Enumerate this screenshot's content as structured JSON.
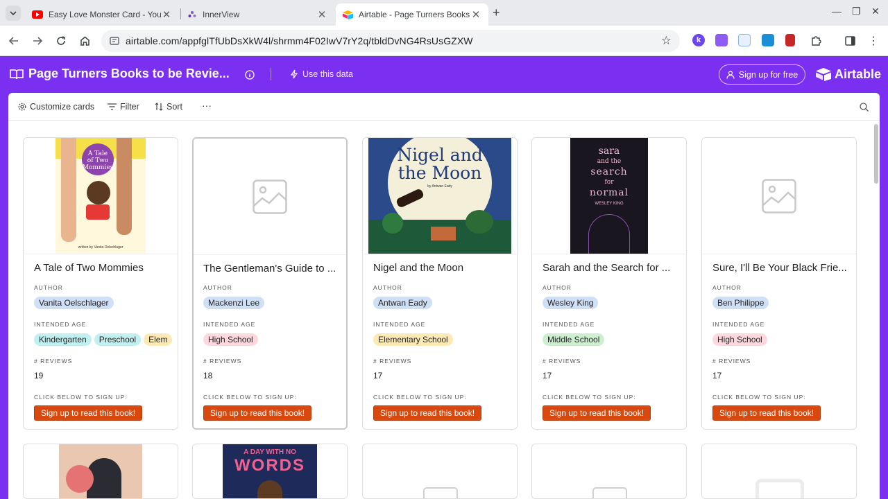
{
  "browser": {
    "tabs": [
      {
        "title": "Easy Love Monster Card - YouT",
        "icon": "youtube-icon"
      },
      {
        "title": "InnerView",
        "icon": "innerview-icon"
      },
      {
        "title": "Airtable - Page Turners Books f",
        "icon": "airtable-icon"
      }
    ],
    "url": "airtable.com/appfglTfUbDsXkW4l/shrmm4F02IwV7rY2q/tbldDvNG4RsUsGZXW"
  },
  "header": {
    "title": "Page Turners Books to be Revie...",
    "use_data": "Use this data",
    "signup": "Sign up for free",
    "logo": "Airtable"
  },
  "viewbar": {
    "customize": "Customize cards",
    "filter": "Filter",
    "sort": "Sort",
    "more": "···"
  },
  "fields": {
    "author": "AUTHOR",
    "age": "INTENDED AGE",
    "reviews": "# REVIEWS",
    "click": "CLICK BELOW TO SIGN UP:"
  },
  "cards": [
    {
      "title": "A Tale of Two Mommies",
      "author": "Vanita Oelschlager",
      "ages": [
        "Kindergarten",
        "Preschool",
        "Elem"
      ],
      "reviews": "19",
      "button": "Sign up to read this book!"
    },
    {
      "title": "The Gentleman's Guide to ...",
      "author": "Mackenzi Lee",
      "ages": [
        "High School"
      ],
      "reviews": "18",
      "button": "Sign up to read this book!"
    },
    {
      "title": "Nigel and the Moon",
      "author": "Antwan Eady",
      "ages": [
        "Elementary School"
      ],
      "reviews": "17",
      "button": "Sign up to read this book!"
    },
    {
      "title": "Sarah and the Search for ...",
      "author": "Wesley King",
      "ages": [
        "Middle School"
      ],
      "reviews": "17",
      "button": "Sign up to read this book!"
    },
    {
      "title": "Sure, I'll Be Your Black Frie...",
      "author": "Ben Philippe",
      "ages": [
        "High School"
      ],
      "reviews": "17",
      "button": "Sign up to read this book!"
    }
  ],
  "covers": {
    "c1": {
      "title_line1": "A Tale",
      "title_line2": "of Two",
      "title_line3": "Mommies",
      "byline": "written by Vanita Oelschlager"
    },
    "c3": {
      "title_line1": "Nigel and",
      "title_line2": "the Moon",
      "byline": "by Antwan Eady"
    },
    "c4": {
      "l1": "sara",
      "l2": "and the",
      "l3": "search",
      "l4": "for",
      "l5": "normal",
      "byline": "WESLEY KING"
    },
    "c7": {
      "l1": "A DAY WITH NO",
      "l2": "WORDS"
    }
  },
  "colors": {
    "accent": "#7b2ff0",
    "button": "#d9480f",
    "pill_blue": "#cfdff5",
    "pill_cyan": "#c2f0f0",
    "pill_yellow": "#fde9b4",
    "pill_pink": "#fdd8df",
    "pill_green": "#cdefd0"
  }
}
